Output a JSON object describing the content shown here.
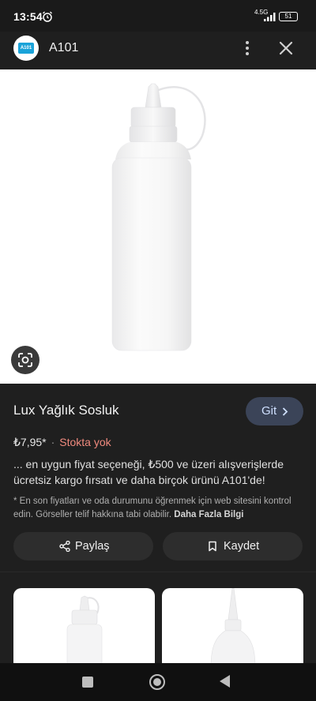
{
  "status_bar": {
    "time": "13:54",
    "network": "4.5G",
    "battery": "51"
  },
  "header": {
    "logo_text": "A101",
    "title": "A101"
  },
  "product": {
    "title": "Lux Yağlık Sosluk",
    "go_button": "Git",
    "price": "₺7,95*",
    "separator": "·",
    "stock": "Stokta yok",
    "description": "... en uygun fiyat seçeneği, ₺500 ve üzeri alışverişlerde ücretsiz kargo fırsatı ve daha birçok ürünü A101'de!",
    "note": "* En son fiyatları ve oda durumunu öğrenmek için web sitesini kontrol edin. Görseller telif hakkına tabi olabilir.",
    "more_link": "Daha Fazla Bilgi",
    "share_label": "Paylaş",
    "save_label": "Kaydet"
  },
  "icons": {
    "alarm": "alarm-clock-icon",
    "signal": "signal-icon",
    "more": "more-vertical-icon",
    "close": "close-icon",
    "lens": "google-lens-icon",
    "share": "share-icon",
    "bookmark": "bookmark-icon",
    "chevron": "chevron-right-icon"
  },
  "colors": {
    "background": "#1f1f1f",
    "stock_out": "#f08a7e",
    "go_button_bg": "#3b4458",
    "go_button_text": "#cfe0ff"
  }
}
